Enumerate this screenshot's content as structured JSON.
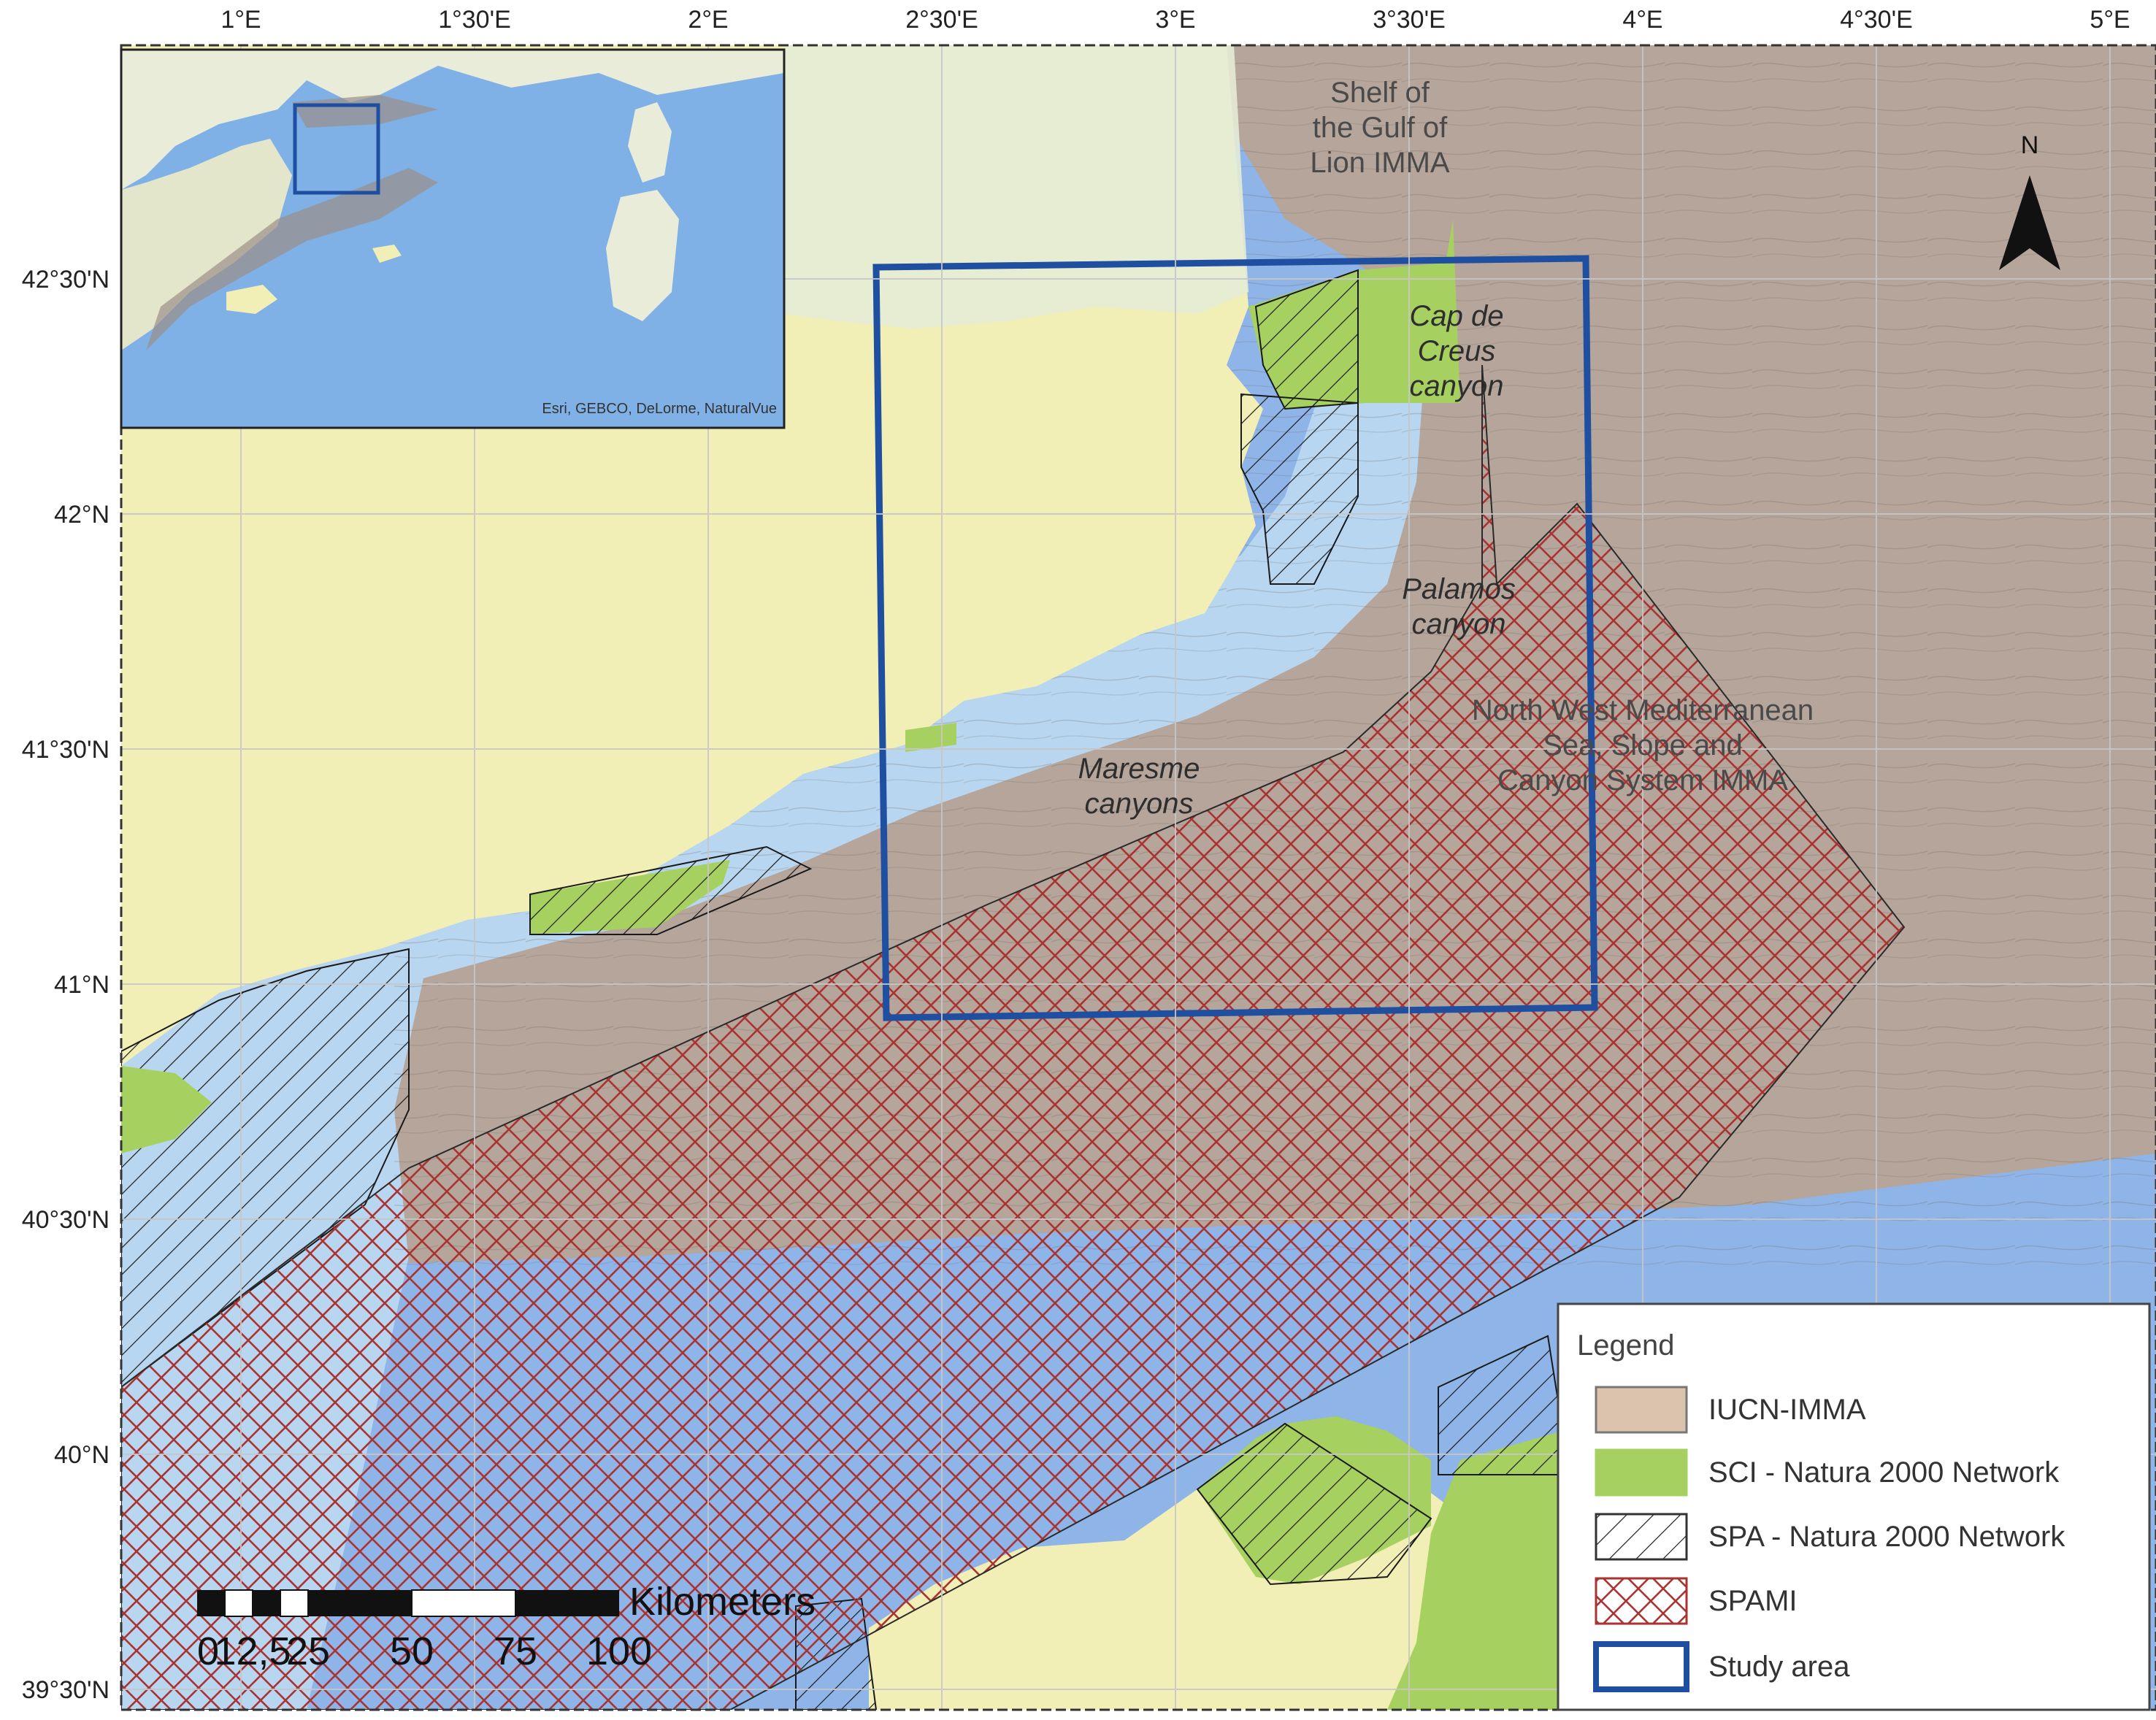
{
  "map": {
    "lon_labels": [
      "1°E",
      "1°30'E",
      "2°E",
      "2°30'E",
      "3°E",
      "3°30'E",
      "4°E",
      "4°30'E",
      "5°E"
    ],
    "lat_labels": [
      "42°30'N",
      "42°N",
      "41°30'N",
      "41°N",
      "40°30'N",
      "40°N",
      "39°30'N"
    ],
    "north_label": "N",
    "inset_credit": "Esri, GEBCO, DeLorme, NaturalVue",
    "zones": {
      "gulf_lion_line1": "Shelf of",
      "gulf_lion_line2": "the Gulf of",
      "gulf_lion_line3": "Lion IMMA",
      "cap_creus_line1": "Cap de",
      "cap_creus_line2": "Creus",
      "cap_creus_line3": "canyon",
      "palamos_line1": "Palamos",
      "palamos_line2": "canyon",
      "nw_med_line1": "North West Mediterranean",
      "nw_med_line2": "Sea, Slope and",
      "nw_med_line3": "Canyon System IMMA",
      "maresme_line1": "Maresme",
      "maresme_line2": "canyons"
    },
    "colors": {
      "land": "#f1eeb6",
      "shelf_water": "#b8d6f0",
      "deep_water": "#8fb4e8",
      "imma": "#b5a59a",
      "sci": "#a6d05f",
      "spami_hatch": "#a93533",
      "study_area": "#1e4fa0"
    }
  },
  "scale_bar": {
    "unit": "Kilometers",
    "ticks": [
      "0",
      "12,5",
      "25",
      "50",
      "75",
      "100"
    ]
  },
  "legend": {
    "title": "Legend",
    "items": [
      {
        "label": "IUCN-IMMA",
        "key": "imma"
      },
      {
        "label": "SCI - Natura 2000 Network",
        "key": "sci"
      },
      {
        "label": "SPA - Natura 2000 Network",
        "key": "spa"
      },
      {
        "label": "SPAMI",
        "key": "spami"
      },
      {
        "label": "Study area",
        "key": "study"
      }
    ]
  }
}
